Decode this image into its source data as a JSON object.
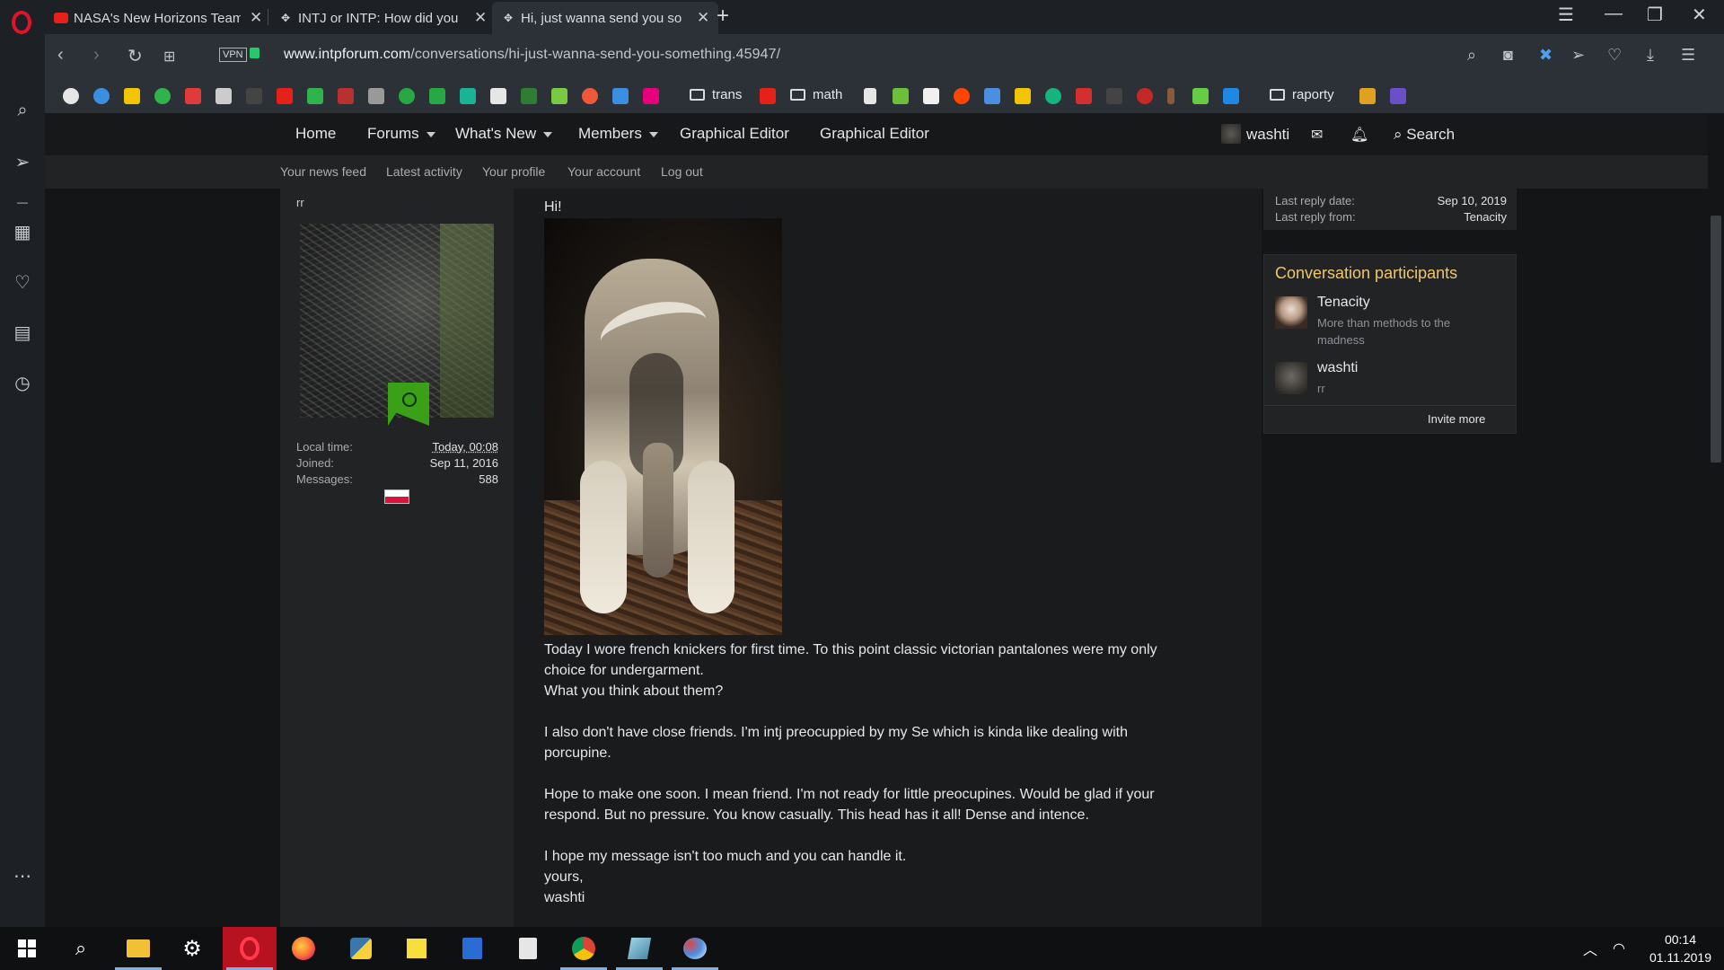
{
  "browser": {
    "tabs": [
      {
        "title": "NASA's New Horizons Team",
        "icon": "youtube-icon",
        "active": false
      },
      {
        "title": "INTJ or INTP: How did you",
        "icon": "forum-icon",
        "active": false
      },
      {
        "title": "Hi, just wanna send you so",
        "icon": "forum-icon",
        "active": true
      }
    ],
    "url_domain": "www.intpforum.com",
    "url_path": "/conversations/hi-just-wanna-send-you-something.45947/",
    "vpn_label": "VPN",
    "bookmark_folders": [
      {
        "label": "trans"
      },
      {
        "label": "math"
      },
      {
        "label": "raporty"
      }
    ],
    "bookmark_colors": [
      "#e6e6e6",
      "#3b8fe0",
      "#f5c400",
      "#2fb34a",
      "#e03a3a",
      "#cccccc",
      "#444444",
      "#e62117",
      "#2fb34a",
      "#d04040",
      "#e6e6e6",
      "#28a745",
      "#28a745",
      "#1ab394",
      "#e6e6e6",
      "#2f7d32",
      "#7ac943",
      "#f0583a",
      "#3b8fe0",
      "#e6007a"
    ],
    "bookmark_colors_2": [
      "#e6e6e6",
      "#6cbf3a",
      "#f0f0f0",
      "#ff4500",
      "#4a8fe0",
      "#f5c400",
      "#15b37d",
      "#d32f2f",
      "#444444",
      "#c62828",
      "#c0392b",
      "#6c4",
      "#1e88e5"
    ],
    "bookmark_colors_3": [
      "#e0a020",
      "#6b4fc9"
    ]
  },
  "forum_nav": {
    "items": [
      "Home",
      "Forums",
      "What's New",
      "Members",
      "Graphical Editor",
      "Graphical Editor"
    ],
    "user": "washti",
    "search_label": "Search"
  },
  "sub_nav": [
    "Your news feed",
    "Latest activity",
    "Your profile",
    "Your account",
    "Log out"
  ],
  "post_user": {
    "title": "rr",
    "local_time_label": "Local time:",
    "local_time": "Today, 00:08",
    "joined_label": "Joined:",
    "joined": "Sep 11, 2016",
    "messages_label": "Messages:",
    "messages": "588"
  },
  "message": {
    "greeting": "Hi!",
    "p1": "Today I wore french knickers for first time. To this point classic victorian pantalones were my only choice for undergarment.",
    "p1b": "What you think about them?",
    "p2": "I also don't have close friends. I'm intj preocuppied by my Se which is kinda like dealing with porcupine.",
    "p3": "Hope to make one soon. I mean friend. I'm not ready for little preocupines. Would be glad if your respond. But no pressure. You know casually. This head has it all! Dense and intence.",
    "p4": "I hope my message isn't too much and you can handle it.",
    "sign1": "yours,",
    "sign2": "washti"
  },
  "conversation_info": {
    "last_reply_date_label": "Last reply date:",
    "last_reply_date": "Sep 10, 2019",
    "last_reply_from_label": "Last reply from:",
    "last_reply_from": "Tenacity"
  },
  "participants": {
    "title": "Conversation participants",
    "list": [
      {
        "name": "Tenacity",
        "subtitle": "More than methods to the madness"
      },
      {
        "name": "washti",
        "subtitle": "rr"
      }
    ],
    "invite_label": "Invite more"
  },
  "taskbar": {
    "time": "00:14",
    "date": "01.11.2019"
  },
  "colors": {
    "accent_title": "#f0c66a",
    "badge_green": "#3aa017",
    "opera_red": "#e3122b"
  }
}
